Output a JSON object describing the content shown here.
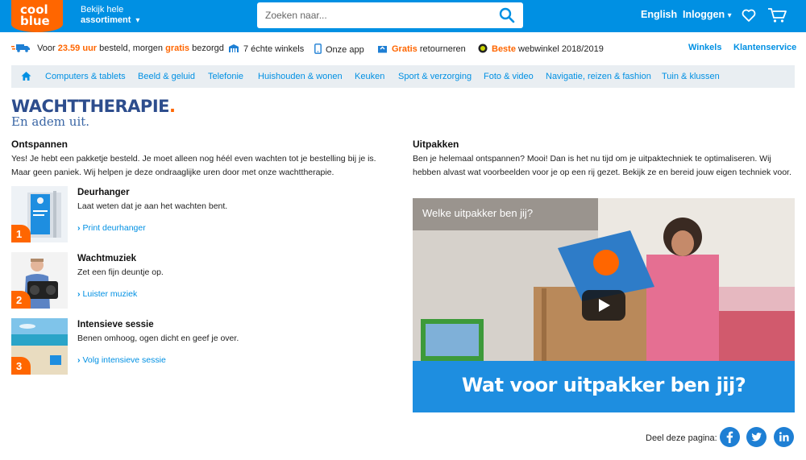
{
  "header": {
    "logo_line1": "cool",
    "logo_line2": "blue",
    "assortment_line1": "Bekijk hele",
    "assortment_line2": "assortiment",
    "search_placeholder": "Zoeken naar...",
    "language": "English",
    "login": "Inloggen"
  },
  "usp": {
    "delivery_pre": "Voor",
    "delivery_time": "23.59 uur",
    "delivery_mid": "besteld, morgen",
    "delivery_free": "gratis",
    "delivery_post": "bezorgd",
    "stores": "7 échte winkels",
    "app": "Onze app",
    "returns_highlight": "Gratis",
    "returns_text": "retourneren",
    "best_highlight": "Beste",
    "best_text": "webwinkel 2018/2019",
    "link_stores": "Winkels",
    "link_service": "Klantenservice"
  },
  "categories": [
    "Computers & tablets",
    "Beeld & geluid",
    "Telefonie",
    "Huishouden & wonen",
    "Keuken",
    "Sport & verzorging",
    "Foto & video",
    "Navigatie, reizen & fashion",
    "Tuin & klussen"
  ],
  "hero": {
    "title": "WACHTTHERAPIE",
    "title_dot": ".",
    "subtitle": "En adem uit."
  },
  "left": {
    "heading": "Ontspannen",
    "intro": "Yes! Je hebt een pakketje besteld. Je moet alleen nog héél even wachten tot je bestelling bij je is. Maar geen paniek. Wij helpen je deze ondraaglijke uren door met onze wachttherapie.",
    "items": [
      {
        "number": "1",
        "title": "Deurhanger",
        "desc": "Laat weten dat je aan het wachten bent.",
        "link": "Print deurhanger"
      },
      {
        "number": "2",
        "title": "Wachtmuziek",
        "desc": "Zet een fijn deuntje op.",
        "link": "Luister muziek"
      },
      {
        "number": "3",
        "title": "Intensieve sessie",
        "desc": "Benen omhoog, ogen dicht en geef je over.",
        "link": "Volg intensieve sessie"
      }
    ]
  },
  "right": {
    "heading": "Uitpakken",
    "intro": "Ben je helemaal ontspannen? Mooi! Dan is het nu tijd om je uitpaktechniek te optimaliseren. Wij hebben alvast wat voorbeelden voor je op een rij gezet. Bekijk ze en bereid jouw eigen techniek voor.",
    "video_title": "Welke uitpakker ben jij?",
    "video_banner": "Wat voor uitpakker ben jij?",
    "box_label": "cool blue"
  },
  "share": {
    "label": "Deel deze pagina:"
  },
  "colors": {
    "brand_blue": "#0090e3",
    "brand_orange": "#ff6600",
    "title_blue": "#2d4d8d"
  }
}
